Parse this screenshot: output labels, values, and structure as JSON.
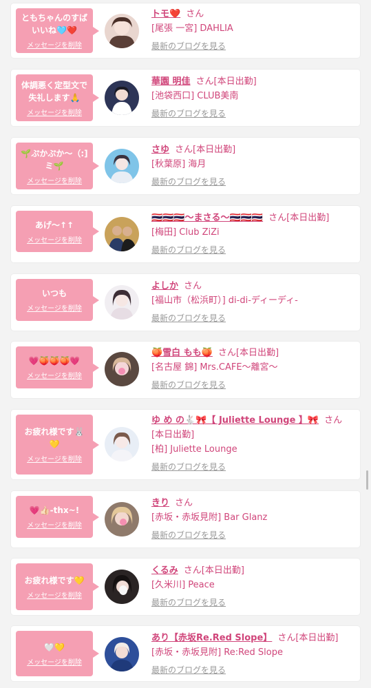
{
  "delete_label": "メッセージを削除",
  "san": "さん",
  "blog_label": "最新のブログを見る",
  "items": [
    {
      "message": "ともちゃんのすばいいね🩵❤️",
      "name": "トモ❤️",
      "status": "",
      "shop": "[尾張 一宮] DAHLIA"
    },
    {
      "message": "体調悪く定型文で失礼します🙏",
      "name": "華園 明佳",
      "status": "[本日出勤]",
      "shop": "[池袋西口] CLUB美南"
    },
    {
      "message": "🌱ぷかぷか〜（:]ミ🌱",
      "name": "さゆ",
      "status": "[本日出勤]",
      "shop": "[秋葉原] 海月"
    },
    {
      "message": "あげ〜↑↑",
      "name": "🇹🇭🇹🇭🇹🇭〜まさる〜🇹🇭🇹🇭🇹🇭",
      "status": "[本日出勤]",
      "shop": "[梅田] Club ZiZi"
    },
    {
      "message": "いつも",
      "name": "よしか",
      "status": "",
      "shop": "[福山市（松浜町）] di-di-ディーディ-"
    },
    {
      "message": "💗🍑🍑🍑💗",
      "name": "🍑雪白 もも🍑",
      "status": "[本日出勤]",
      "shop": "[名古屋 錦] Mrs.CAFE〜離宮〜"
    },
    {
      "message": "お疲れ様です🐰💛",
      "name": "ゆ め の🐇🎀【 Juliette Lounge 】🎀",
      "status": "[本日出勤]",
      "shop": "[柏] Juliette Lounge"
    },
    {
      "message": "💗👍🏻-thx~!",
      "name": "きり",
      "status": "",
      "shop": "[赤坂・赤坂見附] Bar Glanz"
    },
    {
      "message": "お疲れ様です💛",
      "name": "くるみ",
      "status": "[本日出勤]",
      "shop": "[久米川] Peace"
    },
    {
      "message": "🤍💛",
      "name": "あり【赤坂Re.Red Slope】",
      "status": "[本日出勤]",
      "shop": "[赤坂・赤坂見附] Re:Red Slope"
    }
  ]
}
